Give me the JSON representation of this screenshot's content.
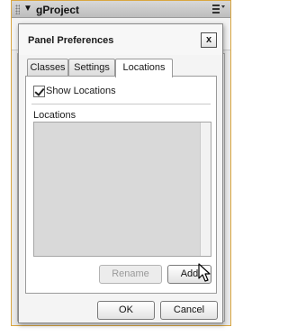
{
  "panel": {
    "title": "gProject",
    "collapse_icon": "triangle-down-icon",
    "menu_icon": "panel-menu-icon"
  },
  "dialog": {
    "title": "Panel Preferences",
    "close_label": "x",
    "tabs": [
      {
        "label": "Classes",
        "active": false
      },
      {
        "label": "Settings",
        "active": false
      },
      {
        "label": "Locations",
        "active": true
      }
    ],
    "show_locations": {
      "label": "Show Locations",
      "checked": true
    },
    "section_label": "Locations",
    "locations_list": [],
    "rename_label": "Rename",
    "add_label": "Add",
    "ok_label": "OK",
    "cancel_label": "Cancel"
  },
  "cursor": "arrow-pointer-icon"
}
